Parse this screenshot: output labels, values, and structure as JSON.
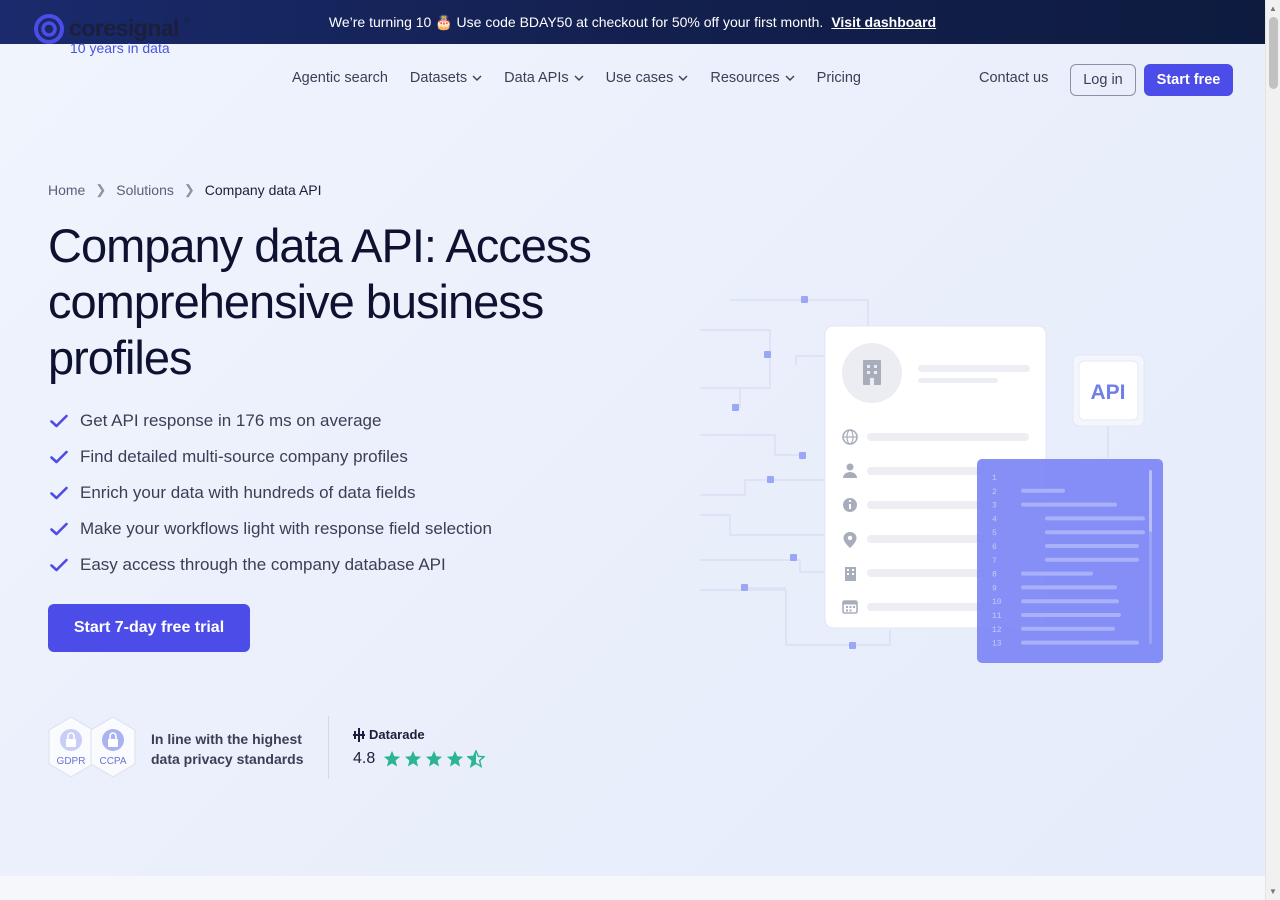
{
  "promo": {
    "text": "We’re turning 10 🎂 Use code BDAY50 at checkout for 50% off your first month.",
    "link": "Visit dashboard"
  },
  "logo": {
    "word": "coresignal",
    "reg": "®",
    "tagline": "10 years in data"
  },
  "nav": {
    "items": [
      {
        "label": "Agentic search",
        "dropdown": false
      },
      {
        "label": "Datasets",
        "dropdown": true
      },
      {
        "label": "Data APIs",
        "dropdown": true
      },
      {
        "label": "Use cases",
        "dropdown": true
      },
      {
        "label": "Resources",
        "dropdown": true
      },
      {
        "label": "Pricing",
        "dropdown": false
      }
    ],
    "contact": "Contact us",
    "login": "Log in",
    "start_free": "Start free"
  },
  "breadcrumb": [
    "Home",
    "Solutions",
    "Company data API"
  ],
  "hero": {
    "title": "Company data API: Access comprehensive business profiles",
    "bullets": [
      "Get API response in 176 ms on average",
      "Find detailed multi-source company profiles",
      "Enrich your data with hundreds of data fields",
      "Make your workflows light with response field selection",
      "Easy access through the company database API"
    ],
    "cta": "Start 7-day free trial"
  },
  "trust": {
    "badges": [
      "GDPR",
      "CCPA"
    ],
    "privacy_text": "In line with the highest data privacy standards",
    "datarade_name": "Datarade",
    "rating": "4.8"
  },
  "illustration": {
    "api_label": "API",
    "line_numbers": [
      "1",
      "2",
      "3",
      "4",
      "5",
      "6",
      "7",
      "8",
      "9",
      "10",
      "11",
      "12",
      "13"
    ]
  },
  "colors": {
    "accent": "#4c4ce8",
    "promo_bg": "#13204f",
    "star": "#2bb594",
    "code_panel": "#7b86f5"
  }
}
